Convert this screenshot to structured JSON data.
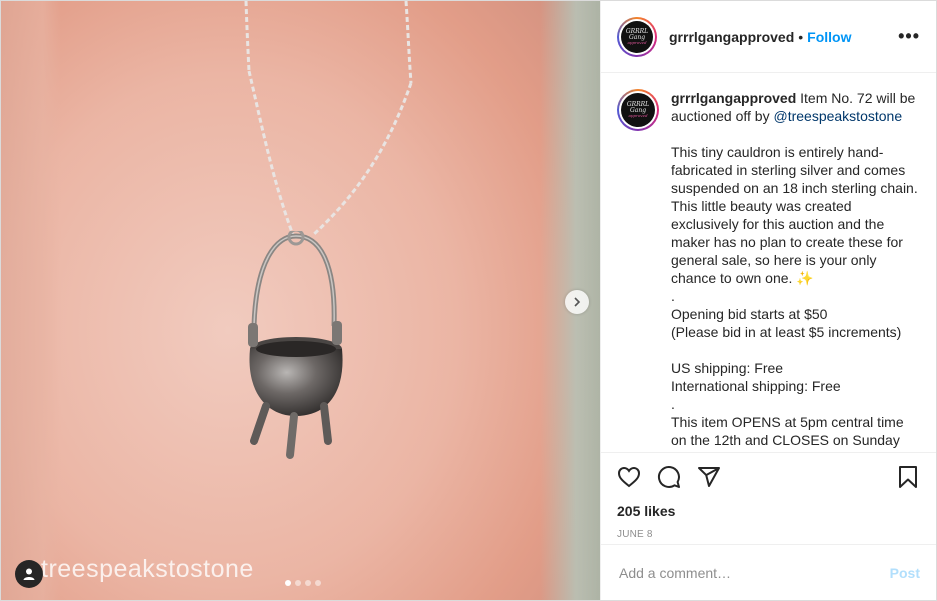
{
  "media": {
    "watermark": "treespeakstostone",
    "carousel_dots": [
      true,
      false,
      false,
      false
    ],
    "icons": {
      "user_tag": "user-tag-icon",
      "next": "chevron-right-icon"
    }
  },
  "header": {
    "username": "grrrlgangapproved",
    "separator": "•",
    "follow_label": "Follow",
    "more_label": "•••"
  },
  "caption": {
    "username": "grrrlgangapproved",
    "intro": " Item No. 72 will be auctioned off by ",
    "mention": "@treespeakstostone",
    "body": "This tiny cauldron is entirely hand-fabricated in sterling silver and comes suspended on an 18 inch sterling chain. This little beauty was created exclusively for this auction and the maker has no plan to create these for general sale, so here is your only chance to own one. ✨\n.\nOpening bid starts at $50\n(Please bid in at least $5 increments)\n\nUS shipping: Free\nInternational shipping: Free\n.\nThis item OPENS at 5pm central time on the 12th and CLOSES on Sunday"
  },
  "actions": {
    "icons": [
      "heart-icon",
      "comment-icon",
      "share-icon",
      "bookmark-icon"
    ],
    "likes": "205 likes",
    "date": "JUNE 8"
  },
  "comment_box": {
    "placeholder": "Add a comment…",
    "post_label": "Post"
  },
  "colors": {
    "accent": "#0095f6",
    "post_disabled": "#b2dffc",
    "mention": "#00376b"
  }
}
